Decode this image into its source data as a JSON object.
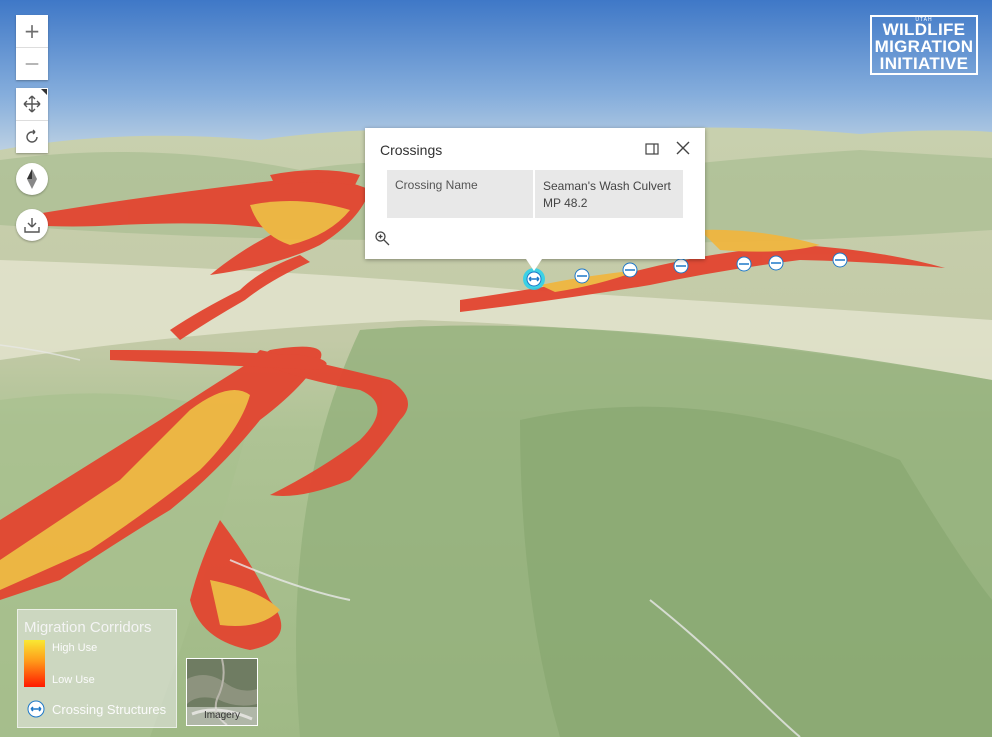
{
  "map": {
    "zoom_in_label": "+",
    "zoom_out_label": "—",
    "pan_icon": "pan-icon",
    "rotate_icon": "rotate-icon",
    "compass_icon": "compass-icon",
    "download_icon": "download-icon"
  },
  "logo": {
    "top_small": "UTAH",
    "line1": "WILDLIFE",
    "line2": "MIGRATION",
    "line3": "INITIATIVE"
  },
  "popup": {
    "title": "Crossings",
    "field_label": "Crossing Name",
    "field_value_line1": "Seaman's Wash Culvert",
    "field_value_line2": "MP 48.2",
    "dock_icon": "dock-icon",
    "close_icon": "close-icon",
    "zoom_icon": "zoom-to-icon"
  },
  "legend": {
    "title": "Migration Corridors",
    "high_label": "High Use",
    "low_label": "Low Use",
    "crossing_label": "Crossing Structures",
    "colors": {
      "high": "#f9e833",
      "mid": "#ff9a1a",
      "low": "#ff1a00"
    }
  },
  "basemap_toggle": {
    "label": "Imagery"
  },
  "colors": {
    "corridor_high": "#f0b640",
    "corridor_low": "#e34530",
    "terrain": "#a9c08c",
    "sky": "#5b8fd0",
    "crossing_marker": "#1e78c8",
    "selected_halo": "#25d1f0"
  }
}
